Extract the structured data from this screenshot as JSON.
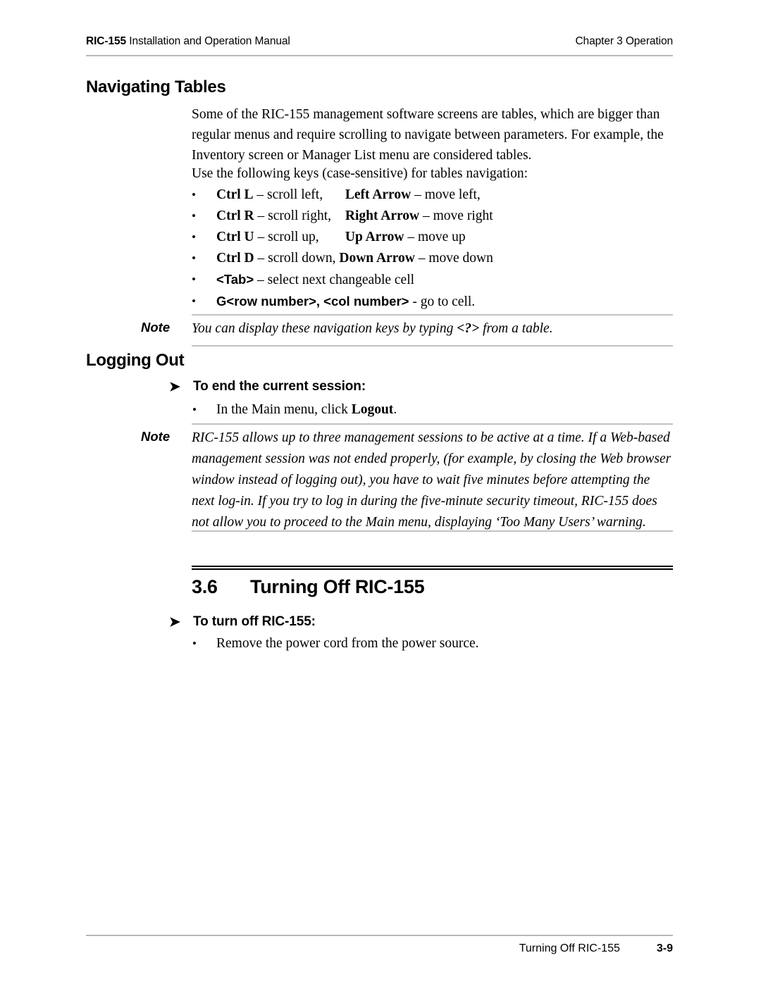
{
  "header": {
    "left_bold": "RIC-155",
    "left_rest": " Installation and Operation Manual",
    "right": "Chapter 3  Operation"
  },
  "sections": {
    "navigating_tables": {
      "heading": "Navigating Tables",
      "intro_paragraph": "Some of the RIC-155 management software screens are tables, which are bigger than regular menus and require scrolling to navigate between parameters. For example, the Inventory screen or Manager List menu are considered tables.",
      "use_keys_line": "Use the following keys (case-sensitive) for tables navigation:",
      "key_bullets": [
        {
          "bullet": "•",
          "col_a_bold": "Ctrl L",
          "col_a_rest": " – scroll left,",
          "col_b_bold": "Left Arrow",
          "col_b_rest": " – move left,"
        },
        {
          "bullet": "•",
          "col_a_bold": "Ctrl R",
          "col_a_rest": " – scroll right,",
          "col_b_bold": "Right Arrow",
          "col_b_rest": " – move right"
        },
        {
          "bullet": "•",
          "col_a_bold": "Ctrl U",
          "col_a_rest": " – scroll up,",
          "col_b_bold": "Up Arrow",
          "col_b_rest": " – move up"
        }
      ],
      "key_bullets_single": [
        {
          "bullet": "•",
          "bold1": "Ctrl D",
          "rest1": " – scroll down, ",
          "bold2": "Down Arrow",
          "rest2": " – move down"
        },
        {
          "bullet": "•",
          "bold1": "<Tab>",
          "rest1": " – select next changeable cell",
          "bold2": "",
          "rest2": ""
        },
        {
          "bullet": "•",
          "bold1": "G<row number>, <col number>",
          "rest1": " - go to cell.",
          "bold2": "",
          "rest2": ""
        }
      ],
      "note": {
        "label": "Note",
        "text_before": "You can display these navigation keys by typing ",
        "text_bold": "<?>",
        "text_after": " from a table."
      }
    },
    "logging_out": {
      "heading": "Logging Out",
      "procedure_heading": "To end the current session:",
      "procedure_arrow": "➤",
      "bullet": {
        "marker": "•",
        "text_before": "In the Main menu, click ",
        "text_bold": "Logout",
        "text_after": "."
      },
      "note": {
        "label": "Note",
        "text": "RIC-155 allows up to three management sessions to be active at a time. If a Web-based management session was not ended properly, (for example, by closing the Web browser window instead of logging out), you have to wait five minutes before attempting the next log-in. If you try to log in during the five-minute security timeout, RIC-155 does not allow you to proceed to the Main menu, displaying ‘Too Many Users’ warning."
      }
    },
    "turning_off": {
      "number": "3.6",
      "title": "Turning Off RIC-155",
      "procedure_arrow": "➤",
      "procedure_heading": "To turn off RIC-155:",
      "bullet": {
        "marker": "•",
        "text": "Remove the power cord from the power source."
      }
    }
  },
  "footer": {
    "title": "Turning Off RIC-155",
    "page_number": "3-9"
  }
}
